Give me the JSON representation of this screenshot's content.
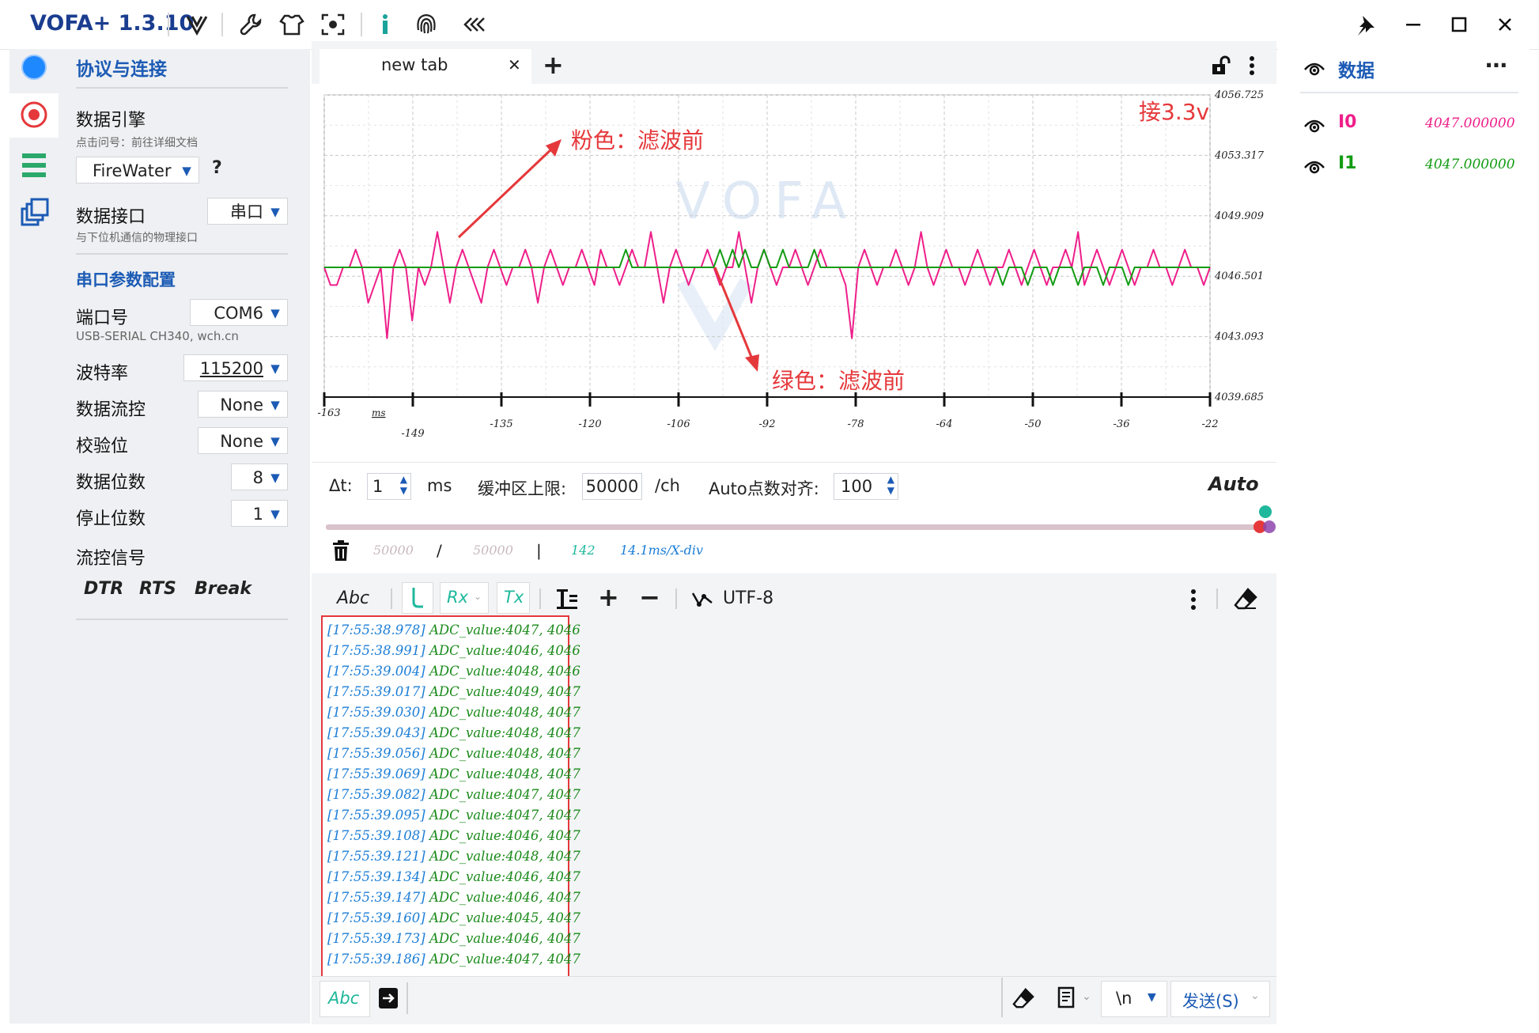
{
  "titlebar": {
    "app_title": "VOFA+ 1.3.10",
    "icons": [
      "vofa-logo-icon",
      "wrench-icon",
      "shirt-icon",
      "screenshot-icon",
      "info-icon",
      "fingerprint-icon",
      "collapse-icon"
    ],
    "pin": "📌",
    "minimize": "—",
    "maximize": "☐",
    "close": "✕"
  },
  "sidebar": {
    "header": "协议与连接",
    "engine_label": "数据引擎",
    "engine_hint": "点击问号：前往详细文档",
    "engine_value": "FireWater",
    "help": "?",
    "interface_label": "数据接口",
    "interface_hint": "与下位机通信的物理接口",
    "interface_value": "串口",
    "serial_header": "串口参数配置",
    "port_label": "端口号",
    "port_value": "COM6",
    "port_desc": "USB-SERIAL CH340, wch.cn",
    "baud_label": "波特率",
    "baud_value": "115200",
    "flowctl_label": "数据流控",
    "flowctl_value": "None",
    "parity_label": "校验位",
    "parity_value": "None",
    "databits_label": "数据位数",
    "databits_value": "8",
    "stopbits_label": "停止位数",
    "stopbits_value": "1",
    "signals_label": "流控信号",
    "signals": [
      "DTR",
      "RTS",
      "Break"
    ]
  },
  "tabs": {
    "active_label": "new tab",
    "close": "✕",
    "add": "+"
  },
  "annotations": {
    "voltage": "接3.3v",
    "pink_note": "粉色：滤波前",
    "green_note": "绿色：滤波前"
  },
  "chart_data": {
    "type": "line",
    "watermark": "VOFA",
    "x_unit": "ms",
    "x_ticks": [
      "-163",
      "-149",
      "-135",
      "-120",
      "-106",
      "-92",
      "-78",
      "-64",
      "-50",
      "-36",
      "-22"
    ],
    "y_ticks": [
      "4056.725",
      "4053.317",
      "4049.909",
      "4046.501",
      "4043.093",
      "4039.685"
    ],
    "ylim": [
      4039.685,
      4056.725
    ],
    "xlim": [
      -163,
      -22
    ],
    "grid": true,
    "colors": {
      "I0": "#ee1f8a",
      "I1": "#139c13"
    },
    "series": [
      {
        "name": "I0",
        "values": [
          4047,
          4046,
          4046,
          4047,
          4047,
          4048,
          4047,
          4045,
          4046,
          4047,
          4043,
          4047,
          4048,
          4047,
          4044,
          4047,
          4046,
          4047,
          4049,
          4047,
          4045,
          4047,
          4048,
          4047,
          4046,
          4045,
          4047,
          4048,
          4047,
          4046,
          4047,
          4047,
          4048,
          4047,
          4045,
          4047,
          4048,
          4047,
          4046,
          4047,
          4047,
          4048,
          4047,
          4046,
          4048,
          4047,
          4047,
          4046,
          4047,
          4048,
          4047,
          4047,
          4049,
          4047,
          4045,
          4047,
          4048,
          4047,
          4046,
          4047,
          4047,
          4048,
          4047,
          4046,
          4047,
          4047,
          4049,
          4047,
          4045,
          4047,
          4048,
          4047,
          4046,
          4047,
          4047,
          4048,
          4047,
          4046,
          4047,
          4048,
          4047,
          4047,
          4047,
          4046,
          4043,
          4047,
          4048,
          4047,
          4046,
          4047,
          4047,
          4048,
          4047,
          4046,
          4047,
          4049,
          4047,
          4046,
          4047,
          4048,
          4047,
          4047,
          4046,
          4047,
          4048,
          4047,
          4046,
          4047,
          4047,
          4048,
          4047,
          4046,
          4047,
          4048,
          4047,
          4046,
          4047,
          4047,
          4048,
          4047,
          4049,
          4046,
          4047,
          4048,
          4047,
          4046,
          4047,
          4048,
          4047,
          4046,
          4047,
          4047,
          4048,
          4047,
          4047,
          4046,
          4047,
          4048,
          4047,
          4047,
          4046,
          4047
        ],
        "note": "raw"
      },
      {
        "name": "I1",
        "values": [
          4047,
          4047,
          4047,
          4047,
          4047,
          4047,
          4047,
          4047,
          4047,
          4047,
          4047,
          4047,
          4047,
          4047,
          4047,
          4047,
          4047,
          4047,
          4047,
          4047,
          4047,
          4047,
          4047,
          4047,
          4047,
          4047,
          4047,
          4047,
          4047,
          4047,
          4047,
          4047,
          4047,
          4047,
          4047,
          4047,
          4047,
          4047,
          4047,
          4047,
          4047,
          4047,
          4047,
          4047,
          4047,
          4047,
          4047,
          4047,
          4048,
          4047,
          4047,
          4047,
          4047,
          4047,
          4047,
          4047,
          4047,
          4047,
          4047,
          4047,
          4047,
          4047,
          4047,
          4048,
          4047,
          4048,
          4047,
          4048,
          4047,
          4047,
          4048,
          4047,
          4047,
          4048,
          4047,
          4047,
          4047,
          4047,
          4048,
          4047,
          4047,
          4047,
          4047,
          4047,
          4047,
          4047,
          4047,
          4047,
          4047,
          4047,
          4047,
          4047,
          4047,
          4047,
          4047,
          4047,
          4047,
          4047,
          4047,
          4047,
          4047,
          4047,
          4047,
          4047,
          4047,
          4047,
          4047,
          4047,
          4046,
          4047,
          4047,
          4047,
          4046,
          4047,
          4047,
          4047,
          4046,
          4047,
          4047,
          4047,
          4046,
          4047,
          4047,
          4047,
          4046,
          4047,
          4047,
          4047,
          4046,
          4047,
          4047,
          4047,
          4047,
          4047,
          4047,
          4047,
          4047,
          4047,
          4047,
          4047,
          4047,
          4047
        ]
      }
    ]
  },
  "controls": {
    "dt_label": "Δt:",
    "dt_value": "1",
    "dt_unit": "ms",
    "buffer_label": "缓冲区上限:",
    "buffer_value": "50000",
    "buffer_unit": "/ch",
    "autoalign_label": "Auto点数对齐:",
    "autoalign_value": "100",
    "auto_label": "Auto",
    "slider_position": 1.0,
    "stats": {
      "count": "50000",
      "sep": "/",
      "total": "50000",
      "bar": "|",
      "visible": "142",
      "rate": "14.1ms/X-div"
    }
  },
  "terminal_toolbar": {
    "abc": "Abc",
    "rx": "Rx",
    "tx": "Tx",
    "plus": "+",
    "minus": "−",
    "encoding": "UTF-8"
  },
  "log": [
    {
      "ts": "[17:55:38.978]",
      "msg": "ADC_value:4047, 4046"
    },
    {
      "ts": "[17:55:38.991]",
      "msg": "ADC_value:4046, 4046"
    },
    {
      "ts": "[17:55:39.004]",
      "msg": "ADC_value:4048, 4046"
    },
    {
      "ts": "[17:55:39.017]",
      "msg": "ADC_value:4049, 4047"
    },
    {
      "ts": "[17:55:39.030]",
      "msg": "ADC_value:4048, 4047"
    },
    {
      "ts": "[17:55:39.043]",
      "msg": "ADC_value:4048, 4047"
    },
    {
      "ts": "[17:55:39.056]",
      "msg": "ADC_value:4048, 4047"
    },
    {
      "ts": "[17:55:39.069]",
      "msg": "ADC_value:4048, 4047"
    },
    {
      "ts": "[17:55:39.082]",
      "msg": "ADC_value:4047, 4047"
    },
    {
      "ts": "[17:55:39.095]",
      "msg": "ADC_value:4047, 4047"
    },
    {
      "ts": "[17:55:39.108]",
      "msg": "ADC_value:4046, 4047"
    },
    {
      "ts": "[17:55:39.121]",
      "msg": "ADC_value:4048, 4047"
    },
    {
      "ts": "[17:55:39.134]",
      "msg": "ADC_value:4046, 4047"
    },
    {
      "ts": "[17:55:39.147]",
      "msg": "ADC_value:4046, 4047"
    },
    {
      "ts": "[17:55:39.160]",
      "msg": "ADC_value:4045, 4047"
    },
    {
      "ts": "[17:55:39.173]",
      "msg": "ADC_value:4046, 4047"
    },
    {
      "ts": "[17:55:39.186]",
      "msg": "ADC_value:4047, 4047"
    }
  ],
  "sendbar": {
    "abc": "Abc",
    "newline": "\\n",
    "send": "发送(S)"
  },
  "right_panel": {
    "title": "数据",
    "more": "⋯",
    "channels": [
      {
        "name": "I0",
        "value": "4047.000000",
        "color": "#ee1f8a"
      },
      {
        "name": "I1",
        "value": "4047.000000",
        "color": "#139c13"
      }
    ]
  }
}
